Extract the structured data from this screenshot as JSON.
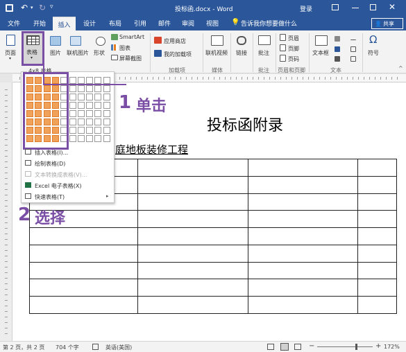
{
  "window": {
    "title": "投标函.docx - Word",
    "user": "登录",
    "share": "共享"
  },
  "tabs": [
    "文件",
    "开始",
    "插入",
    "设计",
    "布局",
    "引用",
    "邮件",
    "审阅",
    "视图"
  ],
  "active_tab": "插入",
  "tell_me": "告诉我你想要做什么",
  "ribbon": {
    "page_btn": "页面",
    "table_btn": "表格",
    "picture_btn": "图片",
    "online_picture_btn": "联机图片",
    "shapes_btn": "形状",
    "smartart_btn": "SmartArt",
    "chart_btn": "图表",
    "screenshot_btn": "屏幕截图",
    "store_btn": "应用商店",
    "my_addins_btn": "我的加载项",
    "online_video_btn": "联机视频",
    "link_btn": "链接",
    "comment_btn": "批注",
    "header_btn": "页眉",
    "footer_btn": "页脚",
    "page_number_btn": "页码",
    "textbox_btn": "文本框",
    "symbol_btn": "符号",
    "groups": {
      "addins": "加载项",
      "media": "媒体",
      "comments": "批注",
      "header_footer": "页眉和页脚",
      "text": "文本"
    }
  },
  "table_grid": {
    "label": "4x8 表格",
    "columns": 10,
    "rows": 8,
    "selected_columns": 4,
    "selected_rows": 8
  },
  "dropdown_menu": [
    {
      "label": "插入表格(I)...",
      "icon": "insert-table-icon",
      "enabled": true
    },
    {
      "label": "绘制表格(D)",
      "icon": "draw-table-icon",
      "enabled": true
    },
    {
      "label": "文本转换成表格(V)...",
      "icon": "convert-text-icon",
      "enabled": false
    },
    {
      "label": "Excel 电子表格(X)",
      "icon": "excel-icon",
      "enabled": true
    },
    {
      "label": "快速表格(T)",
      "icon": "quick-table-icon",
      "enabled": true
    }
  ],
  "annotations": {
    "step1_num": "1",
    "step1_text": "单击",
    "step2_num": "2",
    "step2_text": "选择"
  },
  "document": {
    "heading": "投标函附录",
    "subheading": "庭地板装修工程",
    "table_rows": 9,
    "table_cols": 4
  },
  "status": {
    "page": "第 2 页，共 2 页",
    "words": "704 个字",
    "language": "英语(美国)",
    "zoom": "172%"
  },
  "colors": {
    "accent": "#2b579a",
    "highlight": "#7b4ea6",
    "grid_selected": "#f0a15a"
  }
}
